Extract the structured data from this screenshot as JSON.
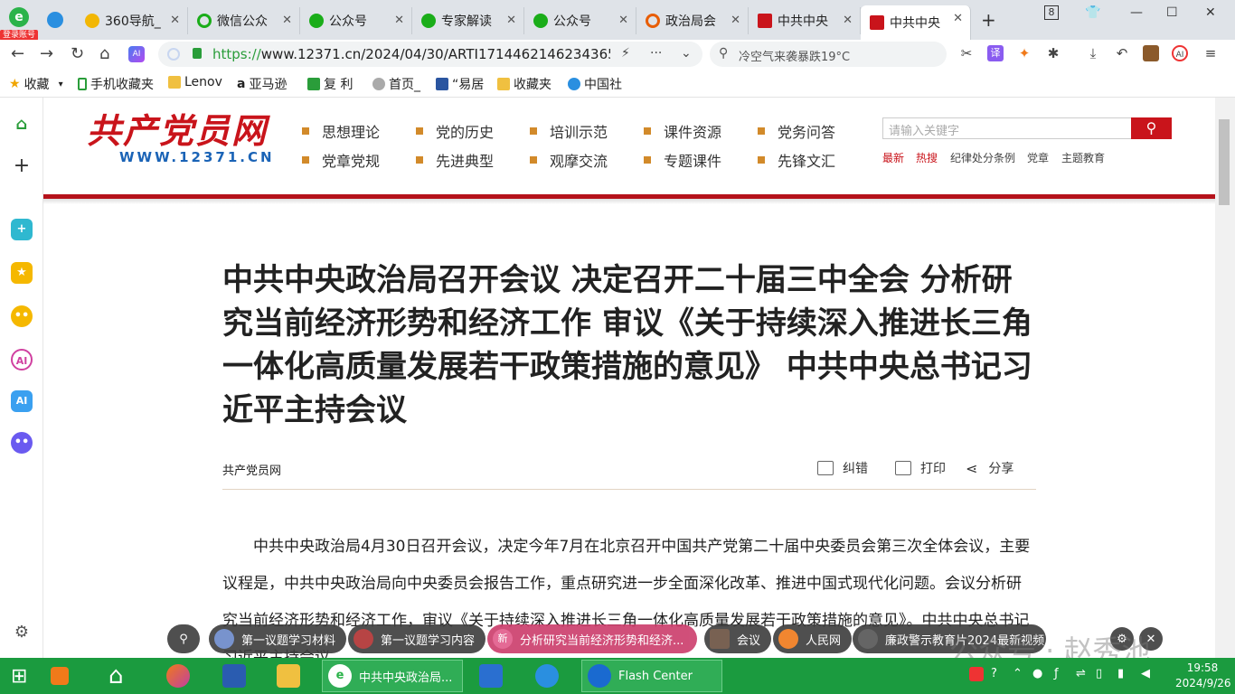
{
  "browser": {
    "login_badge": "登录账号",
    "tabs": [
      {
        "label": "360导航_",
        "color": "#1f9b3a"
      },
      {
        "label": "微信公众",
        "color": "#1aad19"
      },
      {
        "label": "公众号",
        "color": "#1aad19"
      },
      {
        "label": "专家解读",
        "color": "#1aad19"
      },
      {
        "label": "公众号",
        "color": "#1aad19"
      },
      {
        "label": "政治局会",
        "color": "#e85d04"
      },
      {
        "label": "中共中央",
        "color": "#c9141b"
      },
      {
        "label": "中共中央",
        "color": "#c9141b"
      }
    ],
    "tab_count": "8",
    "url": "https://www.12371.cn/2024/04/30/ARTI1714462146234365.s",
    "url_scheme": "https://",
    "url_rest": "www.12371.cn/2024/04/30/ARTI1714462146234365.s",
    "search_text": "冷空气来袭暴跌19°C",
    "bookmarks": [
      "收藏",
      "手机收藏夹",
      "Lenov",
      "亚马逊",
      "复 利",
      "首页_",
      "“易居",
      "收藏夹",
      "中国社"
    ]
  },
  "site": {
    "logo_text": "共产党员网",
    "domain": "WWW.12371.CN",
    "nav": [
      [
        "思想理论",
        "党的历史",
        "培训示范",
        "课件资源",
        "党务问答"
      ],
      [
        "党章党规",
        "先进典型",
        "观摩交流",
        "专题课件",
        "先锋文汇"
      ]
    ],
    "search_placeholder": "请输入关键字",
    "hot_links": [
      "最新",
      "热搜",
      "纪律处分条例",
      "党章",
      "主题教育"
    ]
  },
  "article": {
    "title": "中共中央政治局召开会议 决定召开二十届三中全会 分析研究当前经济形势和经济工作 审议《关于持续深入推进长三角一体化高质量发展若干政策措施的意见》 中共中央总书记习近平主持会议",
    "source": "共产党员网",
    "actions": [
      "纠错",
      "打印",
      "分享"
    ],
    "body": "中共中央政治局4月30日召开会议，决定今年7月在北京召开中国共产党第二十届中央委员会第三次全体会议，主要议程是，中共中央政治局向中央委员会报告工作，重点研究进一步全面深化改革、推进中国式现代化问题。会议分析研究当前经济形势和经济工作，审议《关于持续深入推进长三角一体化高质量发展若干政策措施的意见》。中共中央总书记习近平主持会议。"
  },
  "floatbar": {
    "chips": [
      "第一议题学习材料",
      "第一议题学习内容",
      "分析研究当前经济形势和经济...",
      "会议",
      "人民网",
      "廉政警示教育片2024最新视频"
    ],
    "new_badge": "新"
  },
  "watermark": "公众号 · 赵秀池",
  "taskbar": {
    "items": [
      {
        "label": "中共中央政治局..."
      },
      {
        "label": "Flash Center"
      }
    ],
    "time": "19:58",
    "date": "2024/9/26"
  }
}
